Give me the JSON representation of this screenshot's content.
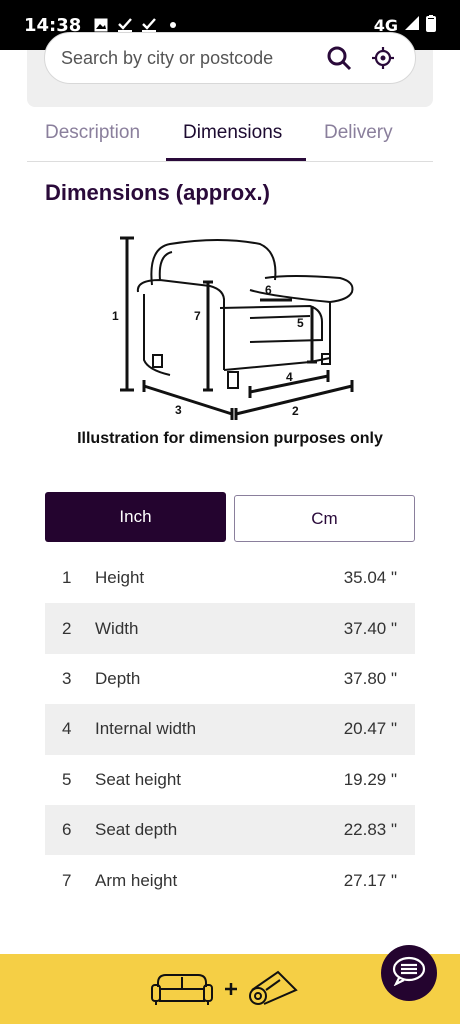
{
  "status_bar": {
    "time": "14:38",
    "network": "4G",
    "icons": [
      "image-icon",
      "check-icon",
      "check-icon",
      "dot-icon"
    ]
  },
  "search": {
    "placeholder": "Search by city or postcode"
  },
  "tabs": [
    {
      "label": "Description"
    },
    {
      "label": "Dimensions"
    },
    {
      "label": "Delivery"
    }
  ],
  "active_tab": "Dimensions",
  "section_title": "Dimensions (approx.)",
  "illustration": {
    "caption": "Illustration for dimension purposes only",
    "markers": [
      "1",
      "2",
      "3",
      "4",
      "5",
      "6",
      "7"
    ]
  },
  "units": {
    "inch_label": "Inch",
    "cm_label": "Cm",
    "selected": "Inch"
  },
  "dimensions": [
    {
      "num": "1",
      "name": "Height",
      "value": "35.04 \""
    },
    {
      "num": "2",
      "name": "Width",
      "value": "37.40 \""
    },
    {
      "num": "3",
      "name": "Depth",
      "value": "37.80 \""
    },
    {
      "num": "4",
      "name": "Internal width",
      "value": "20.47 \""
    },
    {
      "num": "5",
      "name": "Seat height",
      "value": "19.29 \""
    },
    {
      "num": "6",
      "name": "Seat depth",
      "value": "22.83 \""
    },
    {
      "num": "7",
      "name": "Arm height",
      "value": "27.17 \""
    }
  ],
  "colors": {
    "brand_dark": "#24042f",
    "banner_yellow": "#f5cf45",
    "stripe": "#efefef"
  }
}
